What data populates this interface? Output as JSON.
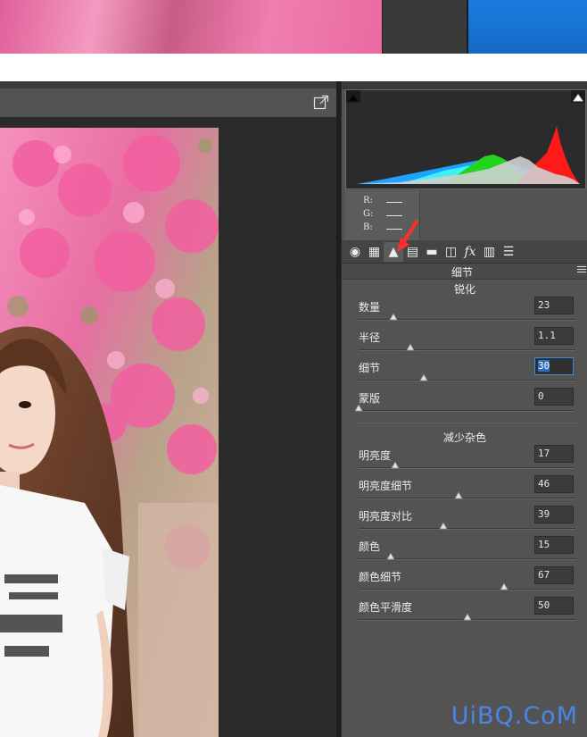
{
  "histogram": {
    "colors": {
      "red": "#ff1a1a",
      "green": "#23d41f",
      "blue": "#1fa2ff",
      "cyan": "#3ef2f2",
      "neutral": "#cfcfcf"
    }
  },
  "rgb_readout": {
    "r_label": "R:",
    "g_label": "G:",
    "b_label": "B:"
  },
  "tabs": [
    {
      "name": "basic",
      "glyph": "◉"
    },
    {
      "name": "tone-curve",
      "glyph": "▦"
    },
    {
      "name": "detail",
      "glyph": "▲"
    },
    {
      "name": "hsl",
      "glyph": "▤"
    },
    {
      "name": "split-toning",
      "glyph": "▬"
    },
    {
      "name": "lens-corrections",
      "glyph": "◫"
    },
    {
      "name": "effects",
      "glyph": "fx"
    },
    {
      "name": "camera-calibration",
      "glyph": "▥"
    },
    {
      "name": "presets",
      "glyph": "☰"
    }
  ],
  "active_tab_index": 2,
  "panel": {
    "section_title": "细节",
    "sharpening": {
      "title": "锐化",
      "sliders": [
        {
          "label": "数量",
          "value": "23",
          "position": 0.16
        },
        {
          "label": "半径",
          "value": "1.1",
          "position": 0.24
        },
        {
          "label": "细节",
          "value": "30",
          "position": 0.3,
          "focused": true
        },
        {
          "label": "蒙版",
          "value": "0",
          "position": 0.0
        }
      ]
    },
    "noise_reduction": {
      "title": "减少杂色",
      "sliders": [
        {
          "label": "明亮度",
          "value": "17",
          "position": 0.17
        },
        {
          "label": "明亮度细节",
          "value": "46",
          "position": 0.46
        },
        {
          "label": "明亮度对比",
          "value": "39",
          "position": 0.39
        },
        {
          "label": "颜色",
          "value": "15",
          "position": 0.15
        },
        {
          "label": "颜色细节",
          "value": "67",
          "position": 0.67
        },
        {
          "label": "颜色平滑度",
          "value": "50",
          "position": 0.5
        }
      ]
    }
  },
  "watermark": "UiBQ.CoM",
  "accent_color": "#3a8dde"
}
